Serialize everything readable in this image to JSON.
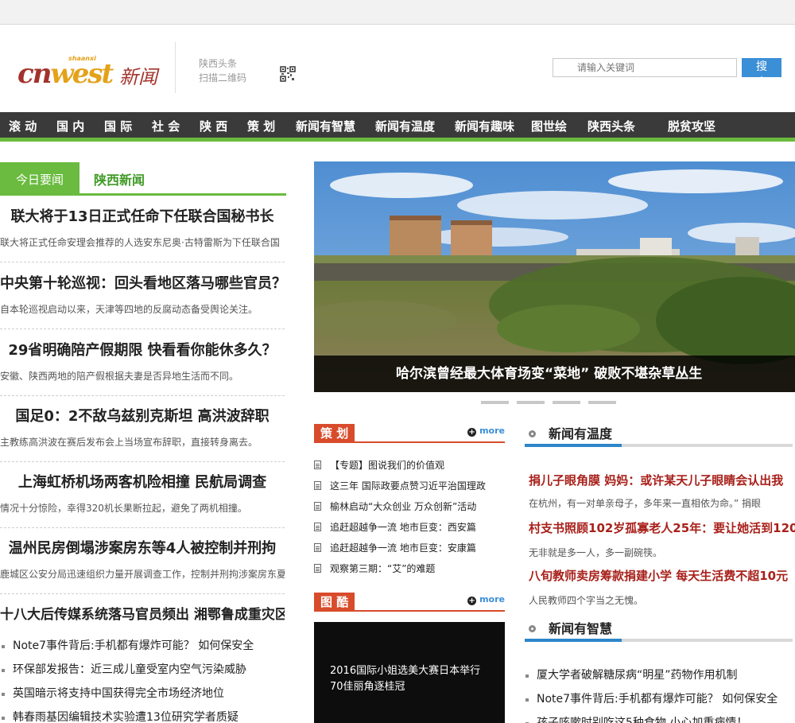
{
  "header": {
    "qr_line1": "陕西头条",
    "qr_line2": "扫描二维码",
    "search_placeholder": "请输入关键词",
    "search_button": "搜 索",
    "logo_text_main": "cn",
    "logo_text_accent": "west",
    "logo_text_small": "shaanxi",
    "logo_text_cn": "新闻"
  },
  "nav": {
    "items": [
      "滚 动",
      "国 内",
      "国 际",
      "社 会",
      "陕 西",
      "策 划",
      "新闻有智慧",
      "新闻有温度",
      "新闻有趣味",
      "图世绘",
      "陕西头条",
      "脱贫攻坚"
    ]
  },
  "news_tabs": {
    "active": "今日要闻",
    "inactive": "陕西新闻"
  },
  "headlines": [
    {
      "title": "联大将于13日正式任命下任联合国秘书长",
      "summary": "联大将正式任命安理会推荐的人选安东尼奥·古特雷斯为下任联合国"
    },
    {
      "title": "中央第十轮巡视：回头看地区落马哪些官员？",
      "summary": "自本轮巡视启动以来，天津等四地的反腐动态备受舆论关注。"
    },
    {
      "title": "29省明确陪产假期限 快看看你能休多久？",
      "summary": "安徽、陕西两地的陪产假根据夫妻是否异地生活而不同。"
    },
    {
      "title": "国足0：2不敌乌兹别克斯坦 高洪波辞职",
      "summary": "主教练高洪波在赛后发布会上当场宣布辞职，直接转身离去。"
    },
    {
      "title": "上海虹桥机场两客机险相撞 民航局调查",
      "summary": "情况十分惊险，幸得320机长果断拉起，避免了两机相撞。"
    },
    {
      "title": "温州民房倒塌涉案房东等4人被控制并刑拘",
      "summary": "鹿城区公安分局迅速组织力量开展调查工作，控制并刑拘涉案房东夏"
    },
    {
      "title": "十八大后传媒系统落马官员频出 湘鄂鲁成重灾区",
      "summary": ""
    }
  ],
  "small_news": [
    "Note7事件背后:手机都有爆炸可能？ 如何保安全",
    "环保部发报告：近三成儿童受室内空气污染威胁",
    "英国暗示将支持中国获得完全市场经济地位",
    "韩春雨基因编辑技术实验遭13位研究学者质疑"
  ],
  "slider": {
    "caption": "哈尔滨曾经最大体育场变“菜地” 破败不堪杂草丛生"
  },
  "cehua": {
    "tag": "策 划",
    "more": "more",
    "items": [
      "【专题】图说我们的价值观",
      "这三年 国际政要点赞习近平治国理政",
      "榆林启动“大众创业 万众创新”活动",
      "追赶超越争一流 地市巨变：西安篇",
      "追赶超越争一流 地市巨变：安康篇",
      "观察第三期：“艾”的难题"
    ]
  },
  "tuku": {
    "tag": "图 酷",
    "more": "more",
    "caption": "2016国际小姐选美大赛日本举行 70佳丽角逐桂冠"
  },
  "warm": {
    "title": "新闻有温度",
    "items": [
      {
        "title": "捐儿子眼角膜 妈妈：或许某天儿子眼睛会认出我",
        "summary": "在杭州，有一对单亲母子，多年来一直相依为命。” 捐眼"
      },
      {
        "title": "村支书照顾102岁孤寡老人25年：要让她活到120岁",
        "summary": "无非就是多一人，多一副碗筷。"
      },
      {
        "title": "八旬教师卖房筹款捐建小学 每天生活费不超10元",
        "summary": "人民教师四个字当之无愧。"
      }
    ]
  },
  "wisdom": {
    "title": "新闻有智慧",
    "items": [
      "厦大学者破解糖尿病“明星”药物作用机制",
      "Note7事件背后:手机都有爆炸可能？ 如何保安全",
      "孩子咳嗽时别吃这5种食物 小心加重病情！"
    ]
  },
  "colors": {
    "nav_bg": "#3a3a3a",
    "accent_green": "#6abb3f",
    "accent_red": "#d84b2b",
    "accent_blue": "#3b8fd6",
    "headline_red": "#a8201a"
  }
}
